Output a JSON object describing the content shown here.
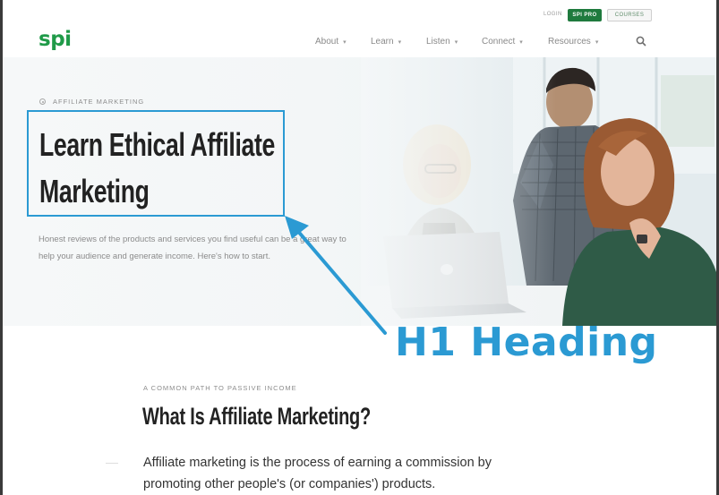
{
  "header": {
    "logo": "spi",
    "utility": {
      "login": "LOGIN",
      "pro": "SPI PRO",
      "courses": "COURSES"
    },
    "nav": [
      {
        "label": "About"
      },
      {
        "label": "Learn"
      },
      {
        "label": "Listen"
      },
      {
        "label": "Connect"
      },
      {
        "label": "Resources"
      }
    ],
    "search_icon": "search-icon"
  },
  "hero": {
    "eyebrow": "AFFILIATE MARKETING",
    "title_line1": "Learn Ethical Affiliate",
    "title_line2": "Marketing",
    "subtitle": "Honest reviews of the products and services you find useful can be a great way to help your audience and generate income. Here's how to start."
  },
  "annotation": {
    "label": "H1 Heading",
    "color": "#2b9ad3"
  },
  "article": {
    "eyebrow": "A COMMON PATH TO PASSIVE INCOME",
    "heading": "What Is Affiliate Marketing?",
    "paragraph": "Affiliate marketing is the process of earning a commission by promoting other people's (or companies') products."
  },
  "colors": {
    "brand_green": "#1f9a48",
    "pro_green": "#1f7a3e",
    "annotation_blue": "#2b9ad3"
  }
}
